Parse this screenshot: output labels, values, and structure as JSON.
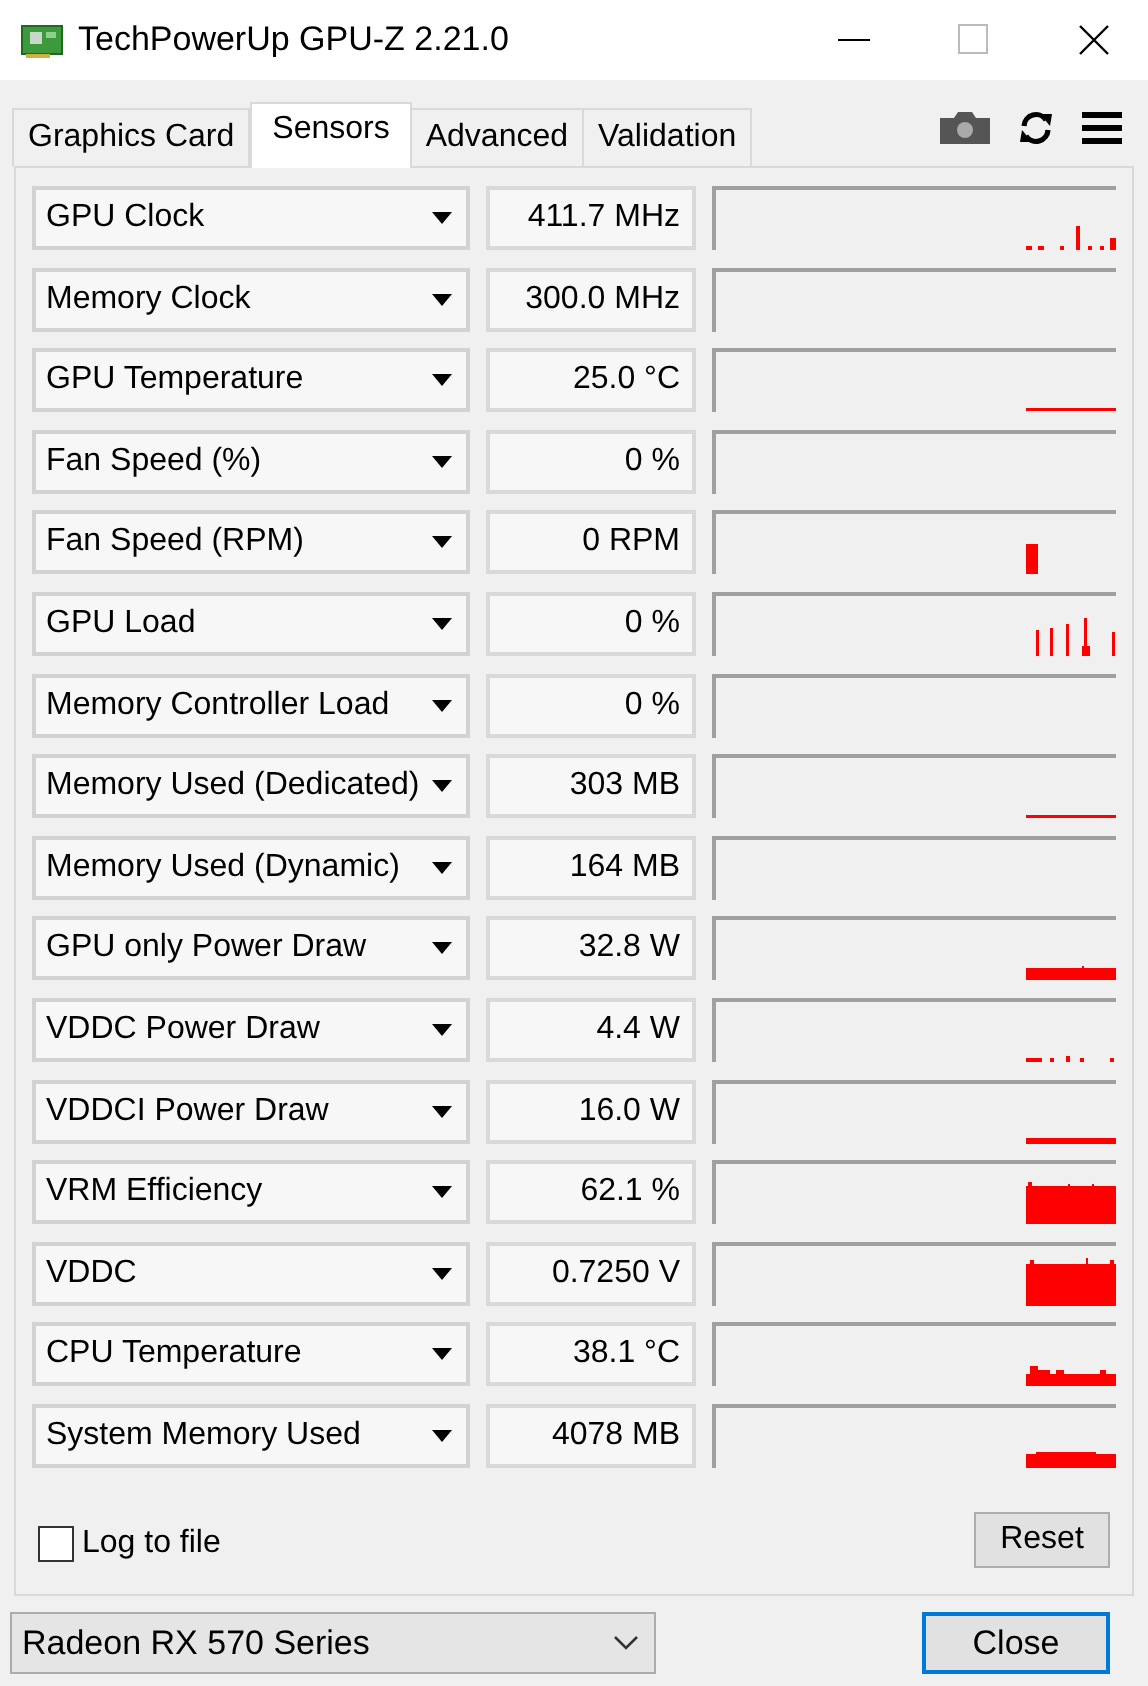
{
  "window": {
    "title": "TechPowerUp GPU-Z 2.21.0"
  },
  "tabs": [
    {
      "label": "Graphics Card",
      "selected": false
    },
    {
      "label": "Sensors",
      "selected": true
    },
    {
      "label": "Advanced",
      "selected": false
    },
    {
      "label": "Validation",
      "selected": false
    }
  ],
  "sensors": [
    {
      "name": "GPU Clock",
      "value": "411.7 MHz"
    },
    {
      "name": "Memory Clock",
      "value": "300.0 MHz"
    },
    {
      "name": "GPU Temperature",
      "value": "25.0 °C"
    },
    {
      "name": "Fan Speed (%)",
      "value": "0 %"
    },
    {
      "name": "Fan Speed (RPM)",
      "value": "0 RPM"
    },
    {
      "name": "GPU Load",
      "value": "0 %"
    },
    {
      "name": "Memory Controller Load",
      "value": "0 %"
    },
    {
      "name": "Memory Used (Dedicated)",
      "value": "303 MB"
    },
    {
      "name": "Memory Used (Dynamic)",
      "value": "164 MB"
    },
    {
      "name": "GPU only Power Draw",
      "value": "32.8 W"
    },
    {
      "name": "VDDC Power Draw",
      "value": "4.4 W"
    },
    {
      "name": "VDDCI Power Draw",
      "value": "16.0 W"
    },
    {
      "name": "VRM Efficiency",
      "value": "62.1 %"
    },
    {
      "name": "VDDC",
      "value": "0.7250 V"
    },
    {
      "name": "CPU Temperature",
      "value": "38.1 °C"
    },
    {
      "name": "System Memory Used",
      "value": "4078 MB"
    }
  ],
  "log_to_file": {
    "label": "Log to file",
    "checked": false
  },
  "reset_button": "Reset",
  "device_select": {
    "value": "Radeon RX 570 Series"
  },
  "close_button": "Close"
}
